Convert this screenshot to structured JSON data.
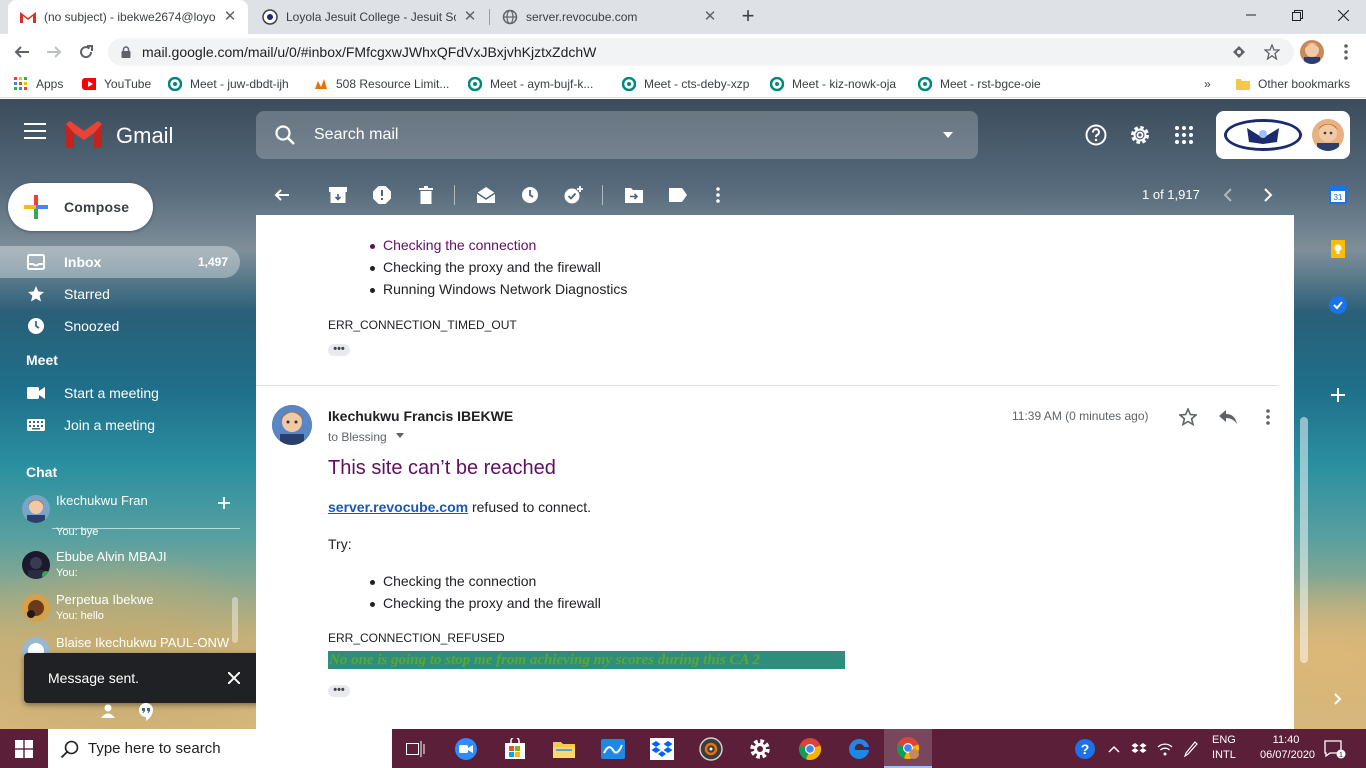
{
  "browser": {
    "tabs": [
      {
        "title": "(no subject) - ibekwe2674@loyol",
        "active": true
      },
      {
        "title": "Loyola Jesuit College - Jesuit Sch",
        "active": false
      },
      {
        "title": "server.revocube.com",
        "active": false
      }
    ],
    "url": "mail.google.com/mail/u/0/#inbox/FMfcgxwJWhxQFdVxJBxjvhKjztxZdchW",
    "bookmarks": [
      {
        "label": "Apps",
        "icon": "apps-grid-icon"
      },
      {
        "label": "YouTube",
        "icon": "youtube-icon"
      },
      {
        "label": "Meet - juw-dbdt-ijh",
        "icon": "meet-icon"
      },
      {
        "label": "508 Resource Limit...",
        "icon": "hosting-icon"
      },
      {
        "label": "Meet - aym-bujf-k...",
        "icon": "meet-icon"
      },
      {
        "label": "Meet - cts-deby-xzp",
        "icon": "meet-icon"
      },
      {
        "label": "Meet - kiz-nowk-oja",
        "icon": "meet-icon"
      },
      {
        "label": "Meet - rst-bgce-oie",
        "icon": "meet-icon"
      }
    ],
    "other_bookmarks": "Other bookmarks",
    "overflow": "»"
  },
  "gmail": {
    "brand": "Gmail",
    "search_placeholder": "Search mail",
    "compose_label": "Compose",
    "nav": [
      {
        "label": "Inbox",
        "count": "1,497",
        "icon": "inbox-icon"
      },
      {
        "label": "Starred",
        "count": "",
        "icon": "star-icon"
      },
      {
        "label": "Snoozed",
        "count": "",
        "icon": "clock-icon"
      }
    ],
    "meet_heading": "Meet",
    "meet_items": [
      {
        "label": "Start a meeting",
        "icon": "video-camera-icon"
      },
      {
        "label": "Join a meeting",
        "icon": "keyboard-icon"
      }
    ],
    "chat_heading": "Chat",
    "chats": [
      {
        "name": "Ikechukwu Fran",
        "message": "You: bye"
      },
      {
        "name": "Ebube Alvin MBAJI",
        "message": "You:"
      },
      {
        "name": "Perpetua Ibekwe",
        "message": "You: hello"
      },
      {
        "name": "Blaise Ikechukwu PAUL-ONW",
        "message": ""
      }
    ],
    "toast": "Message sent.",
    "pagination": "1 of 1,917",
    "thread": {
      "prior_list": [
        "Checking the connection",
        "Checking the proxy and the firewall",
        "Running Windows Network Diagnostics"
      ],
      "prior_error": "ERR_CONNECTION_TIMED_OUT",
      "ellipsis": "•••",
      "sender": "Ikechukwu Francis IBEKWE",
      "recipient": "to Blessing",
      "time": "11:39 AM (0 minutes ago)",
      "site_title": "This site can’t be reached",
      "site_link": "server.revocube.com",
      "site_suffix": " refused to connect.",
      "try_label": "Try:",
      "list": [
        "Checking the connection",
        "Checking the proxy and the firewall"
      ],
      "error": "ERR_CONNECTION_REFUSED",
      "highlight_text": "No one is going to stop me from achieving my scores during this CA 2"
    },
    "side_panel": {
      "calendar_day": "31"
    }
  },
  "taskbar": {
    "search_placeholder": "Type here to search",
    "language": "ENG",
    "layout": "INTL",
    "time": "11:40",
    "date": "06/07/2020",
    "notifications": "1"
  },
  "colors": {
    "visited_link": "#5f0f63",
    "link": "#1a57b6",
    "highlight_bg": "#2f8d7e",
    "highlight_text": "#5aa82e",
    "taskbar": "#5b1f3a"
  }
}
